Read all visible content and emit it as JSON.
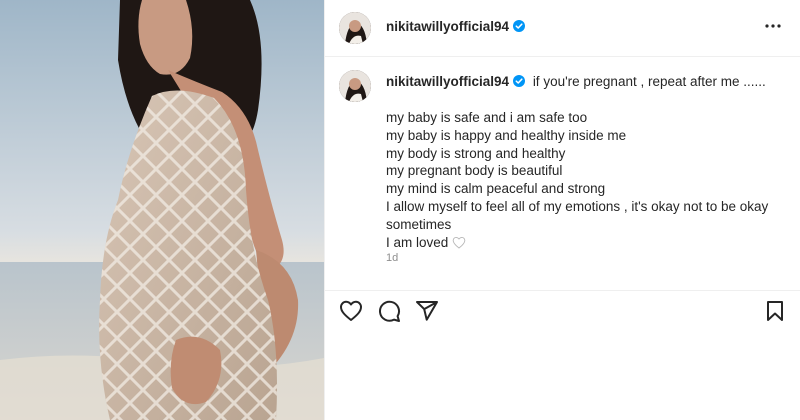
{
  "post": {
    "username": "nikitawillyofficial94",
    "caption_intro": "if you're pregnant , repeat after me ......",
    "caption_lines": [
      "my baby is safe and i am safe too",
      "my baby is happy and healthy inside me",
      "my body is strong and healthy",
      "my pregnant body is beautiful",
      "my mind is calm peaceful and strong",
      "I allow myself to feel all of my emotions , it's okay not to be okay",
      "sometimes",
      "I am loved"
    ],
    "caption_emoji": "white-heart-icon",
    "time_ago": "1d"
  },
  "icons": {
    "verified": "verified-badge-icon",
    "more": "more-options-icon",
    "like": "heart-icon",
    "comment": "comment-icon",
    "share": "share-icon",
    "save": "bookmark-icon"
  },
  "colors": {
    "verified_blue": "#0095f6",
    "text": "#262626",
    "secondary_text": "#8e8e8e",
    "divider": "#efefef"
  }
}
